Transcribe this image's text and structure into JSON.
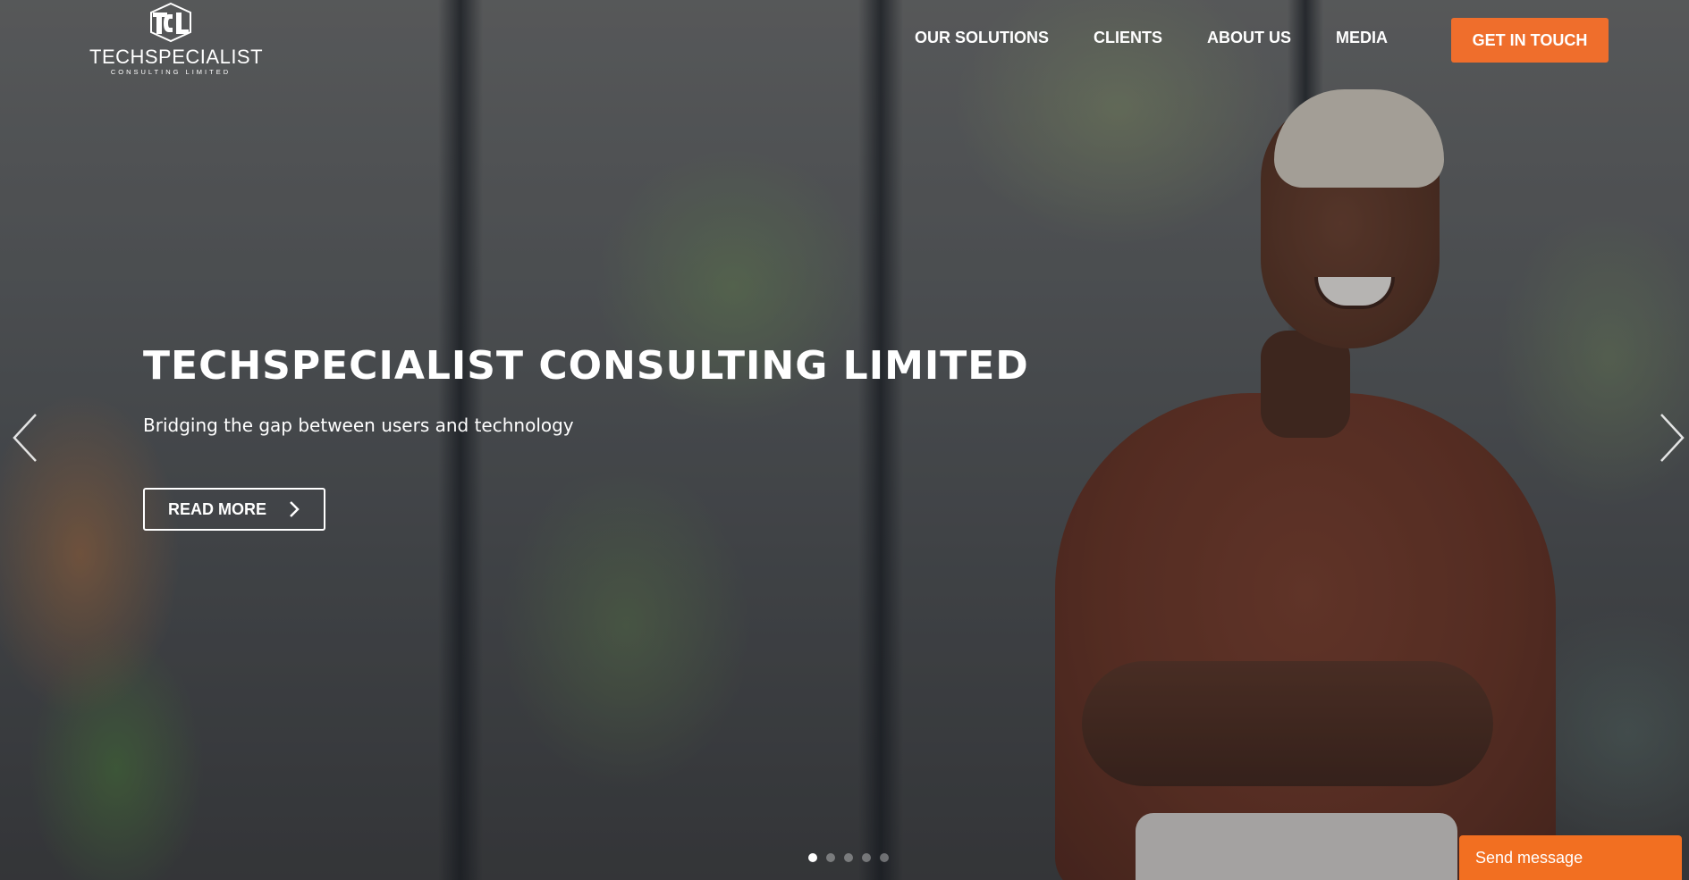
{
  "header": {
    "logo": {
      "brand": "TECHSPECIALIST",
      "tagline": "CONSULTING LIMITED"
    },
    "nav": [
      {
        "label": "OUR SOLUTIONS"
      },
      {
        "label": "CLIENTS"
      },
      {
        "label": "ABOUT US"
      },
      {
        "label": "MEDIA"
      }
    ],
    "cta_label": "GET IN TOUCH"
  },
  "hero": {
    "title": "TECHSPECIALIST CONSULTING LIMITED",
    "subtitle": "Bridging the gap between users and technology",
    "button_label": "READ MORE",
    "slide_count": 5,
    "active_slide": 1
  },
  "chat": {
    "label": "Send message"
  },
  "colors": {
    "accent": "#ef6e2c",
    "text": "#ffffff"
  },
  "icons": {
    "prev": "chevron-left-icon",
    "next": "chevron-right-icon",
    "button": "chevron-right-icon"
  }
}
